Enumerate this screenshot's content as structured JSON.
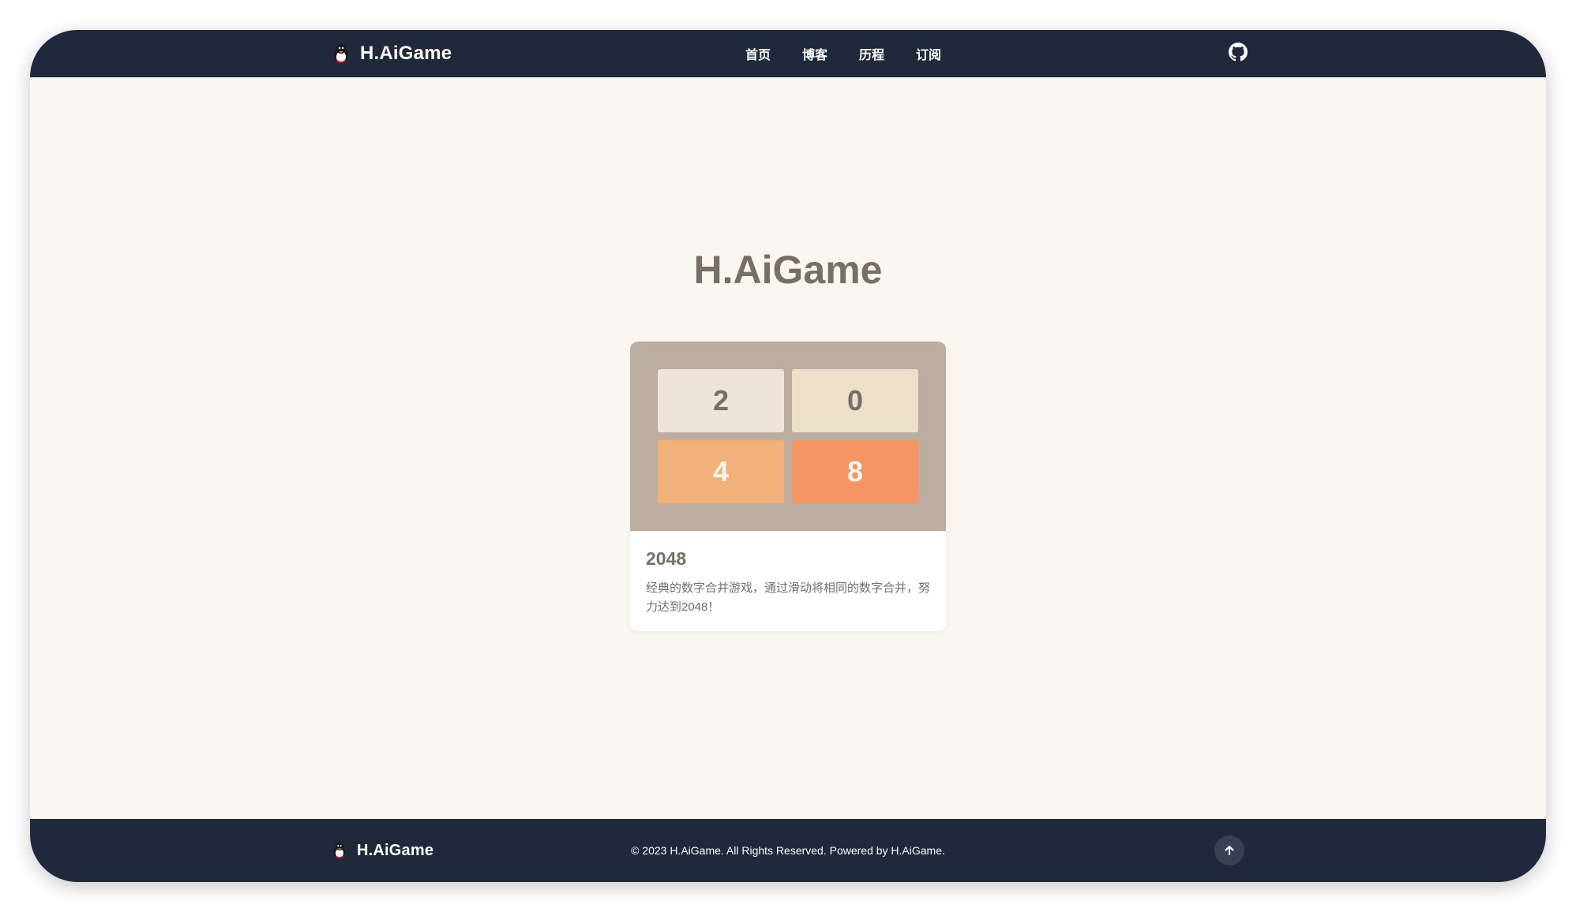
{
  "header": {
    "brand_name": "H.AiGame",
    "nav": [
      {
        "label": "首页"
      },
      {
        "label": "博客"
      },
      {
        "label": "历程"
      },
      {
        "label": "订阅"
      }
    ],
    "github_icon": "github-icon"
  },
  "hero": {
    "title": "H.AiGame"
  },
  "games": [
    {
      "tiles": [
        "2",
        "0",
        "4",
        "8"
      ],
      "tile_colors": [
        "#eee4da",
        "#ede0c8",
        "#f2b179",
        "#f59563"
      ],
      "title": "2048",
      "description": "经典的数字合并游戏，通过滑动将相同的数字合并，努力达到2048！"
    }
  ],
  "footer": {
    "brand_name": "H.AiGame",
    "copyright": "© 2023 H.AiGame. All Rights Reserved. Powered by H.AiGame.",
    "back_to_top_icon": "arrow-up-icon"
  },
  "colors": {
    "bar": "#1f293b",
    "page_bg": "#faf7f0",
    "text": "#776e65",
    "board": "#bbada0"
  }
}
